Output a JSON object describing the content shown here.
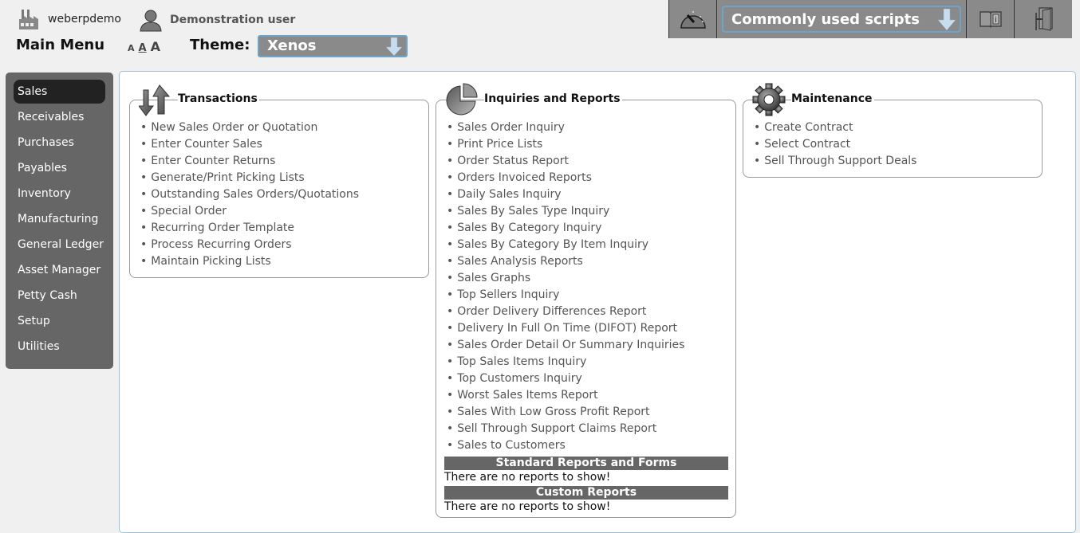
{
  "header": {
    "company": "weberpdemo",
    "user": "Demonstration user",
    "main_menu_title": "Main Menu",
    "font_sizes": [
      "A",
      "A",
      "A"
    ],
    "theme_label": "Theme:",
    "theme_value": "Xenos"
  },
  "toolbar": {
    "dashboard_icon": "speedometer-icon",
    "scripts_select": "Commonly used scripts",
    "manual_icon": "manual-book-icon",
    "logout_icon": "logout-door-icon"
  },
  "sidebar": {
    "active": "Sales",
    "items": [
      {
        "label": "Sales"
      },
      {
        "label": "Receivables"
      },
      {
        "label": "Purchases"
      },
      {
        "label": "Payables"
      },
      {
        "label": "Inventory"
      },
      {
        "label": "Manufacturing"
      },
      {
        "label": "General Ledger"
      },
      {
        "label": "Asset Manager"
      },
      {
        "label": "Petty Cash"
      },
      {
        "label": "Setup"
      },
      {
        "label": "Utilities"
      }
    ]
  },
  "panels": {
    "transactions": {
      "title": "Transactions",
      "icon": "transactions-arrows-icon",
      "items": [
        "New Sales Order or Quotation",
        "Enter Counter Sales",
        "Enter Counter Returns",
        "Generate/Print Picking Lists",
        "Outstanding Sales Orders/Quotations",
        "Special Order",
        "Recurring Order Template",
        "Process Recurring Orders",
        "Maintain Picking Lists"
      ]
    },
    "inquiries": {
      "title": "Inquiries and Reports",
      "icon": "pie-chart-icon",
      "items": [
        "Sales Order Inquiry",
        "Print Price Lists",
        "Order Status Report",
        "Orders Invoiced Reports",
        "Daily Sales Inquiry",
        "Sales By Sales Type Inquiry",
        "Sales By Category Inquiry",
        "Sales By Category By Item Inquiry",
        "Sales Analysis Reports",
        "Sales Graphs",
        "Top Sellers Inquiry",
        "Order Delivery Differences Report",
        "Delivery In Full On Time (DIFOT) Report",
        "Sales Order Detail Or Summary Inquiries",
        "Top Sales Items Inquiry",
        "Top Customers Inquiry",
        "Worst Sales Items Report",
        "Sales With Low Gross Profit Report",
        "Sell Through Support Claims Report",
        "Sales to Customers"
      ],
      "standard_reports_header": "Standard Reports and Forms",
      "standard_reports_empty": "There are no reports to show!",
      "custom_reports_header": "Custom Reports",
      "custom_reports_empty": "There are no reports to show!"
    },
    "maintenance": {
      "title": "Maintenance",
      "icon": "gear-icon",
      "items": [
        "Create Contract",
        "Select Contract",
        "Sell Through Support Deals"
      ]
    }
  }
}
